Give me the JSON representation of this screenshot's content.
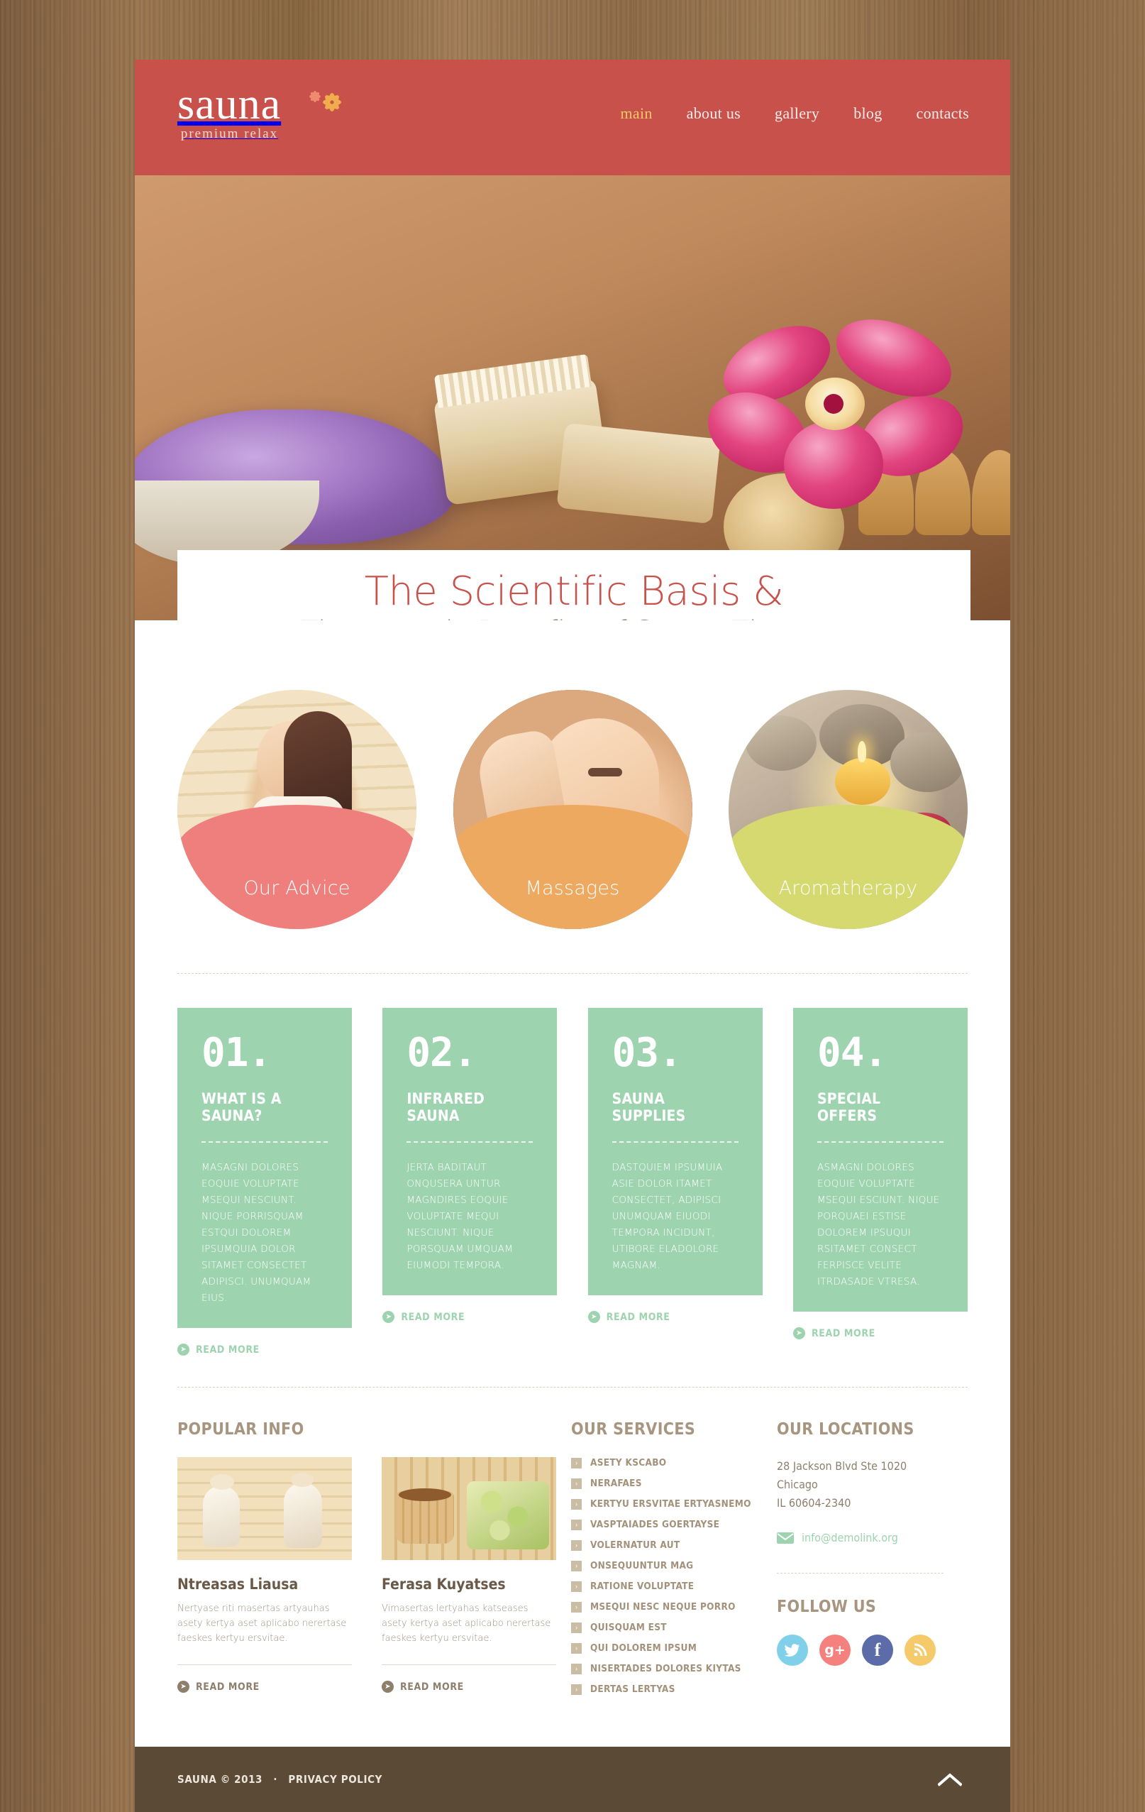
{
  "header": {
    "logo_word": "sauna",
    "logo_tagline": "premium relax",
    "nav": [
      {
        "label": "main",
        "active": true
      },
      {
        "label": "about us",
        "active": false
      },
      {
        "label": "gallery",
        "active": false
      },
      {
        "label": "blog",
        "active": false
      },
      {
        "label": "contacts",
        "active": false
      }
    ]
  },
  "hero": {
    "title": "The Scientific Basis &",
    "subtitle": "Therapeutic Benefits of Sauna Therapy",
    "slides": 4,
    "active_slide": 1
  },
  "circles": [
    {
      "label": "Our Advice",
      "color": "#ef7f7c"
    },
    {
      "label": "Massages",
      "color": "#eda960"
    },
    {
      "label": "Aromatherapy",
      "color": "#d5d96f"
    }
  ],
  "boxes": [
    {
      "num": "01.",
      "title": "WHAT IS A SAUNA?",
      "text": "MASAGNI DOLORES EOQUIE VOLUPTATE MSEQUI NESCIUNT. NIQUE PORRISQUAM ESTQUI DOLOREM IPSUMQUIA DOLOR SITAMET CONSECTET ADIPISCI. UNUMQUAM EIUS.",
      "read_more": "READ MORE"
    },
    {
      "num": "02.",
      "title": "INFRARED SAUNA",
      "text": "JERTA BADITAUT ONQUSERA UNTUR MAGNDIRES EOQUIE VOLUPTATE MEQUI NESCIUNT. NIQUE PORSQUAM UMQUAM EIUMODI TEMPORA.",
      "read_more": "READ MORE"
    },
    {
      "num": "03.",
      "title": "SAUNA SUPPLIES",
      "text": "DASTQUIEM IPSUMUIA ASIE DOLOR ITAMET CONSECTET, ADIPISCI UNUMQUAM EIUODI TEMPORA INCIDUNT, UTIBORE ELADOLORE MAGNAM.",
      "read_more": "READ MORE"
    },
    {
      "num": "04.",
      "title": "SPECIAL OFFERS",
      "text": "ASMAGNI DOLORES EOQUIE VOLUPTATE MSEQUI ESCIUNT. NIQUE PORQUAEI ESTISE DOLOREM IPSUQUI RSITAMET CONSECT FERPISCE VELITE ITRDASADE VTRESA.",
      "read_more": "READ MORE"
    }
  ],
  "popular": {
    "title": "POPULAR INFO",
    "posts": [
      {
        "title": "Ntreasas Liausa",
        "text": "Nertyase riti masertas artyauhas asety kertya aset aplicabo nerertase faeskes kertyu ersvitae.",
        "read_more": "READ MORE"
      },
      {
        "title": "Ferasa Kuyatses",
        "text": "Vimasertas lertyahas katseases asety kertya aset aplicabo nerertase faeskes kertyu ersvitae.",
        "read_more": "READ MORE"
      }
    ]
  },
  "services": {
    "title": "OUR SERVICES",
    "items": [
      "ASETY KSCABO",
      "NERAFAES",
      "KERTYU ERSVITAE ERTYASNEMO",
      "VASPTAIADES GOERTAYSE",
      "VOLERNATUR AUT",
      "ONSEQUUNTUR MAG",
      "RATIONE VOLUPTATE",
      "MSEQUI NESC NEQUE PORRO",
      "QUISQUAM EST",
      "QUI DOLOREM IPSUM",
      "NISERTADES DOLORES KIYTAS",
      "DERTAS LERTYAS"
    ]
  },
  "locations": {
    "title": "OUR LOCATIONS",
    "address_line1": "28 Jackson Blvd Ste 1020",
    "address_line2": "Chicago",
    "address_line3": "IL 60604-2340",
    "email": "info@demolink.org"
  },
  "follow": {
    "title": "FOLLOW US",
    "socials": [
      {
        "name": "twitter",
        "glyph": "❦",
        "color": "#7fd0e8"
      },
      {
        "name": "google-plus",
        "glyph": "g+",
        "color": "#f5817f"
      },
      {
        "name": "facebook",
        "glyph": "f",
        "color": "#5b6ca8"
      },
      {
        "name": "rss",
        "glyph": "●",
        "color": "#f5ca6a"
      }
    ]
  },
  "footer": {
    "copyright": "SAUNA © 2013",
    "separator": "·",
    "privacy": "PRIVACY POLICY"
  },
  "colors": {
    "brand_red": "#c9514b",
    "accent_gold": "#f6c866",
    "mint": "#9ed3b0",
    "taupe": "#a89580",
    "footer_brown": "#5b4a36"
  }
}
